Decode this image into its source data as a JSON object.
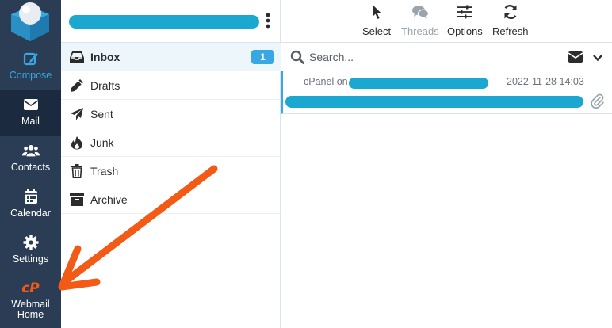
{
  "nav": {
    "items": [
      {
        "label": "Compose"
      },
      {
        "label": "Mail"
      },
      {
        "label": "Contacts"
      },
      {
        "label": "Calendar"
      },
      {
        "label": "Settings"
      },
      {
        "label_line1": "Webmail",
        "label_line2": "Home"
      }
    ],
    "cpanel_logo_text": "cP"
  },
  "folders": {
    "items": [
      {
        "label": "Inbox",
        "badge": "1"
      },
      {
        "label": "Drafts"
      },
      {
        "label": "Sent"
      },
      {
        "label": "Junk"
      },
      {
        "label": "Trash"
      },
      {
        "label": "Archive"
      }
    ]
  },
  "toolbar": {
    "select": "Select",
    "threads": "Threads",
    "options": "Options",
    "refresh": "Refresh"
  },
  "search": {
    "placeholder": "Search..."
  },
  "messages": [
    {
      "from_prefix": "cPanel on",
      "date": "2022-11-28 14:03"
    }
  ],
  "colors": {
    "nav_bg": "#2b3c55",
    "nav_active_bg": "#1b2a3f",
    "accent": "#37a8e2",
    "redaction": "#1aa7d0",
    "annotation_arrow": "#f25a16"
  },
  "icons": {
    "logo": "roundcube-logo-icon",
    "compose": "edit-icon",
    "mail": "envelope-icon",
    "contacts": "users-icon",
    "calendar": "calendar-icon",
    "settings": "gear-icon",
    "webmail_home": "cpanel-logo-icon",
    "inbox": "inbox-icon",
    "drafts": "pencil-icon",
    "sent": "paper-plane-icon",
    "junk": "fire-icon",
    "trash": "trash-icon",
    "archive": "archive-box-icon",
    "select": "cursor-pointer-icon",
    "threads": "chat-bubbles-icon",
    "options": "sliders-icon",
    "refresh": "refresh-icon",
    "search": "search-icon",
    "attachment": "paperclip-icon"
  }
}
